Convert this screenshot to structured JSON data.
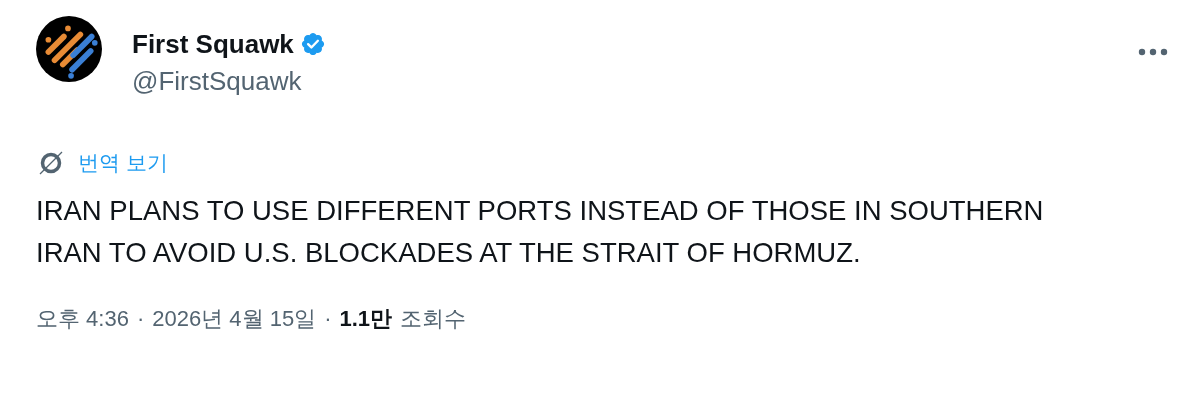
{
  "author": {
    "name": "First Squawk",
    "verified": true,
    "handle": "@FirstSquawk"
  },
  "translate_link": "번역 보기",
  "body": "IRAN PLANS TO USE DIFFERENT PORTS INSTEAD OF THOSE IN SOUTHERN IRAN TO AVOID U.S. BLOCKADES AT THE STRAIT OF HORMUZ.",
  "meta": {
    "time": "오후 4:36",
    "separator_1": "·",
    "date": "2026년 4월 15일",
    "separator_2": "·",
    "views_count": "1.1만",
    "views_label": "조회수"
  }
}
